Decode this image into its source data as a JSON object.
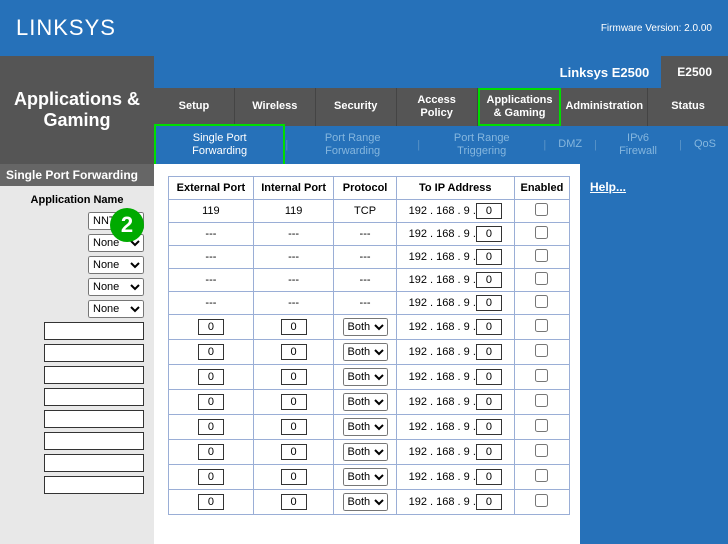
{
  "header": {
    "brand": "LINKSYS",
    "firmware": "Firmware Version: 2.0.00"
  },
  "model": {
    "name": "Linksys E2500",
    "code": "E2500"
  },
  "page_title": "Applications & Gaming",
  "nav": [
    {
      "label": "Setup"
    },
    {
      "label": "Wireless"
    },
    {
      "label": "Security"
    },
    {
      "label": "Access Policy"
    },
    {
      "label": "Applications & Gaming",
      "active": true
    },
    {
      "label": "Administration"
    },
    {
      "label": "Status"
    }
  ],
  "subnav": [
    {
      "label": "Single Port Forwarding",
      "active": true
    },
    {
      "label": "Port Range Forwarding"
    },
    {
      "label": "Port Range Triggering"
    },
    {
      "label": "DMZ"
    },
    {
      "label": "IPv6 Firewall"
    },
    {
      "label": "QoS"
    }
  ],
  "section_title": "Single Port Forwarding",
  "appname_header": "Application Name",
  "step_badge": "2",
  "preset_rows": [
    {
      "app": "NNTP",
      "ext": "119",
      "int": "119",
      "proto": "TCP",
      "ip_prefix": "192 . 168 . 9 .",
      "ip_last": "0"
    },
    {
      "app": "None",
      "ext": "---",
      "int": "---",
      "proto": "---",
      "ip_prefix": "192 . 168 . 9 .",
      "ip_last": "0"
    },
    {
      "app": "None",
      "ext": "---",
      "int": "---",
      "proto": "---",
      "ip_prefix": "192 . 168 . 9 .",
      "ip_last": "0"
    },
    {
      "app": "None",
      "ext": "---",
      "int": "---",
      "proto": "---",
      "ip_prefix": "192 . 168 . 9 .",
      "ip_last": "0"
    },
    {
      "app": "None",
      "ext": "---",
      "int": "---",
      "proto": "---",
      "ip_prefix": "192 . 168 . 9 .",
      "ip_last": "0"
    }
  ],
  "custom_rows_count": 8,
  "custom_defaults": {
    "ext": "0",
    "int": "0",
    "proto": "Both",
    "ip_prefix": "192 . 168 . 9 .",
    "ip_last": "0"
  },
  "table_headers": {
    "external_port": "External Port",
    "internal_port": "Internal Port",
    "protocol": "Protocol",
    "to_ip": "To IP Address",
    "enabled": "Enabled"
  },
  "help_label": "Help..."
}
